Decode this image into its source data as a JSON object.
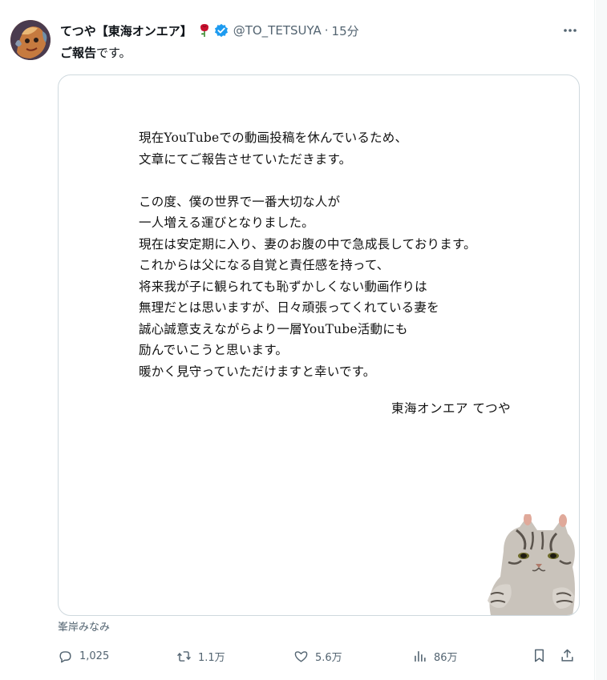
{
  "tweet": {
    "author_name": "てつや【東海オンエア】",
    "handle": "@TO_TETSUYA",
    "separator": "·",
    "time": "15分",
    "text_bold": "ご報告",
    "text_rest": "です。"
  },
  "media": {
    "letter_lines": [
      "現在YouTubeでの動画投稿を休んでいるため、",
      "文章にてご報告させていただきます。",
      "",
      "この度、僕の世界で一番大切な人が",
      "一人増える運びとなりました。",
      "現在は安定期に入り、妻のお腹の中で急成長しております。",
      "これからは父になる自覚と責任感を持って、",
      "将来我が子に観られても恥ずかしくない動画作りは",
      "無理だとは思いますが、日々頑張ってくれている妻を",
      "誠心誠意支えながらより一層YouTube活動にも",
      "励んでいこうと思います。",
      "暖かく見守っていただけますと幸いです。"
    ],
    "signature": "東海オンエア てつや",
    "credit": "峯岸みなみ"
  },
  "actions": {
    "replies": "1,025",
    "retweets": "1.1万",
    "likes": "5.6万",
    "views": "86万"
  },
  "icons": {
    "avatar": "avatar",
    "rose": "rose-emoji-icon",
    "verified": "verified-badge-icon",
    "more": "more-icon",
    "reply": "reply-icon",
    "retweet": "retweet-icon",
    "like": "heart-icon",
    "views": "views-chart-icon",
    "bookmark": "bookmark-icon",
    "share": "share-icon"
  },
  "colors": {
    "text": "#0f1419",
    "secondary": "#536471",
    "verified": "#1d9bf0",
    "border": "#cfd9de"
  }
}
